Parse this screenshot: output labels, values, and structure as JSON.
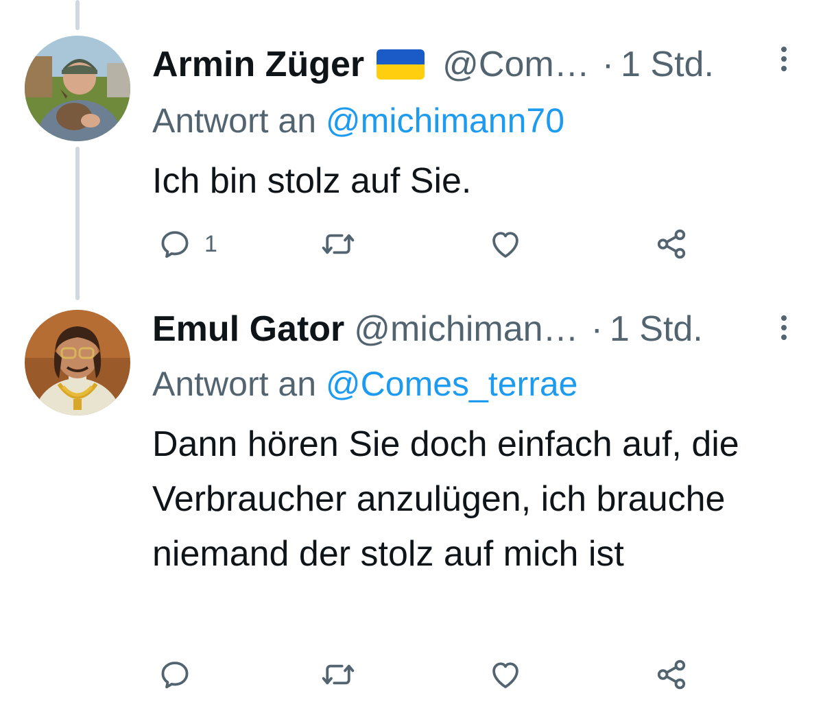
{
  "tweets": [
    {
      "display_name": "Armin Züger",
      "handle": "@Com…",
      "separator": "·",
      "time": "1 Std.",
      "reply_prefix": "Antwort an",
      "reply_to": "@michimann70",
      "text": "Ich bin stolz auf Sie.",
      "reply_count": "1",
      "avatar": "avatar-man-holding-goat"
    },
    {
      "display_name": "Emul Gator",
      "handle": "@michiman…",
      "separator": "·",
      "time": "1 Std.",
      "reply_prefix": "Antwort an",
      "reply_to": "@Comes_terrae",
      "text": "Dann hören Sie doch einfach auf, die Verbraucher anzulügen, ich brauche niemand der stolz auf mich ist",
      "reply_count": "",
      "avatar": "avatar-man-with-gold-chains"
    }
  ],
  "icons": {
    "reply": "reply-icon",
    "retweet": "retweet-icon",
    "like": "like-icon",
    "share": "share-icon",
    "more": "more-icon",
    "flag": "ukraine-flag-icon"
  },
  "colors": {
    "text": "#0f1419",
    "secondary": "#536471",
    "link": "#1d9bf0",
    "thread_line": "#cfd9de",
    "flag_blue": "#1b5bc8",
    "flag_yellow": "#ffcf0f"
  }
}
